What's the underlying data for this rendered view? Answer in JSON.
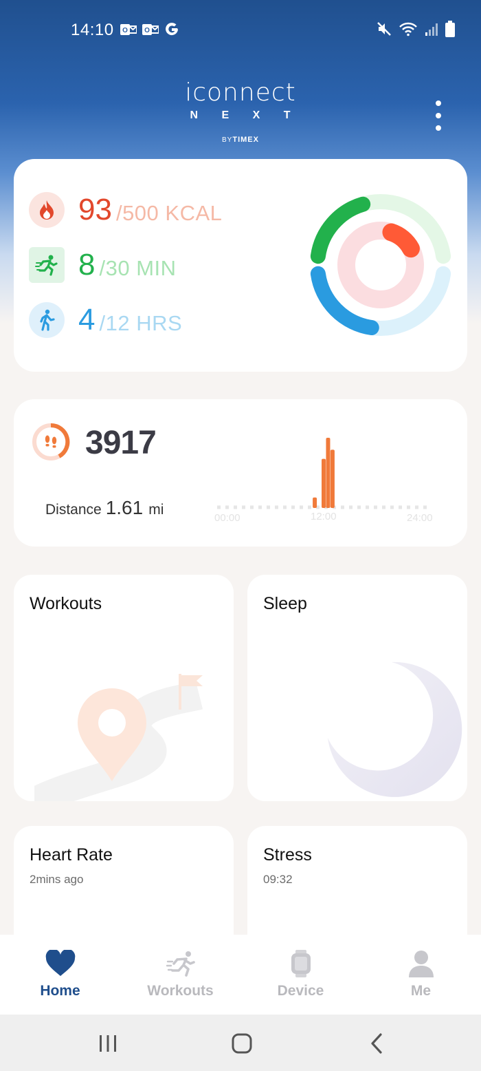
{
  "status_bar": {
    "time": "14:10",
    "notification_icons": [
      "outlook-icon",
      "outlook-icon",
      "google-icon"
    ],
    "system_icons": [
      "mute-icon",
      "wifi-icon",
      "signal-icon",
      "battery-icon"
    ]
  },
  "brand": {
    "name": "iconnect",
    "sub": "N E X T",
    "by": "BY",
    "maker": "TIMEX"
  },
  "activity": {
    "calories": {
      "value": "93",
      "goal": "/500 KCAL",
      "color": "#e2482c",
      "goal_color": "#f5b9a6",
      "progress": 0.186
    },
    "active_minutes": {
      "value": "8",
      "goal": "/30 MIN",
      "color": "#22b14c",
      "goal_color": "#a7e3b2",
      "progress": 0.267
    },
    "active_hours": {
      "value": "4",
      "goal": "/12 HRS",
      "color": "#2a9be0",
      "goal_color": "#a9d8f2",
      "progress": 0.333
    }
  },
  "steps": {
    "count": "3917",
    "distance_label": "Distance",
    "distance_value": "1.61",
    "distance_unit": "mi",
    "accent": "#f07a3a"
  },
  "chart_data": {
    "type": "bar",
    "title": "",
    "xlabel": "",
    "ylabel": "",
    "x_ticks": [
      "00:00",
      "12:00",
      "24:00"
    ],
    "x": [
      11,
      12,
      12.5,
      13
    ],
    "values": [
      15,
      70,
      100,
      83
    ],
    "xlim": [
      0,
      24
    ],
    "color": "#f07a3a"
  },
  "tiles": {
    "workouts": {
      "title": "Workouts"
    },
    "sleep": {
      "title": "Sleep"
    },
    "heart_rate": {
      "title": "Heart Rate",
      "subtitle": "2mins ago"
    },
    "stress": {
      "title": "Stress",
      "subtitle": "09:32"
    }
  },
  "nav": {
    "items": [
      {
        "label": "Home",
        "icon": "heart-icon",
        "active": true
      },
      {
        "label": "Workouts",
        "icon": "runner-icon",
        "active": false
      },
      {
        "label": "Device",
        "icon": "watch-icon",
        "active": false
      },
      {
        "label": "Me",
        "icon": "person-icon",
        "active": false
      }
    ]
  },
  "system_nav": [
    "recent-apps-icon",
    "home-icon",
    "back-icon"
  ]
}
